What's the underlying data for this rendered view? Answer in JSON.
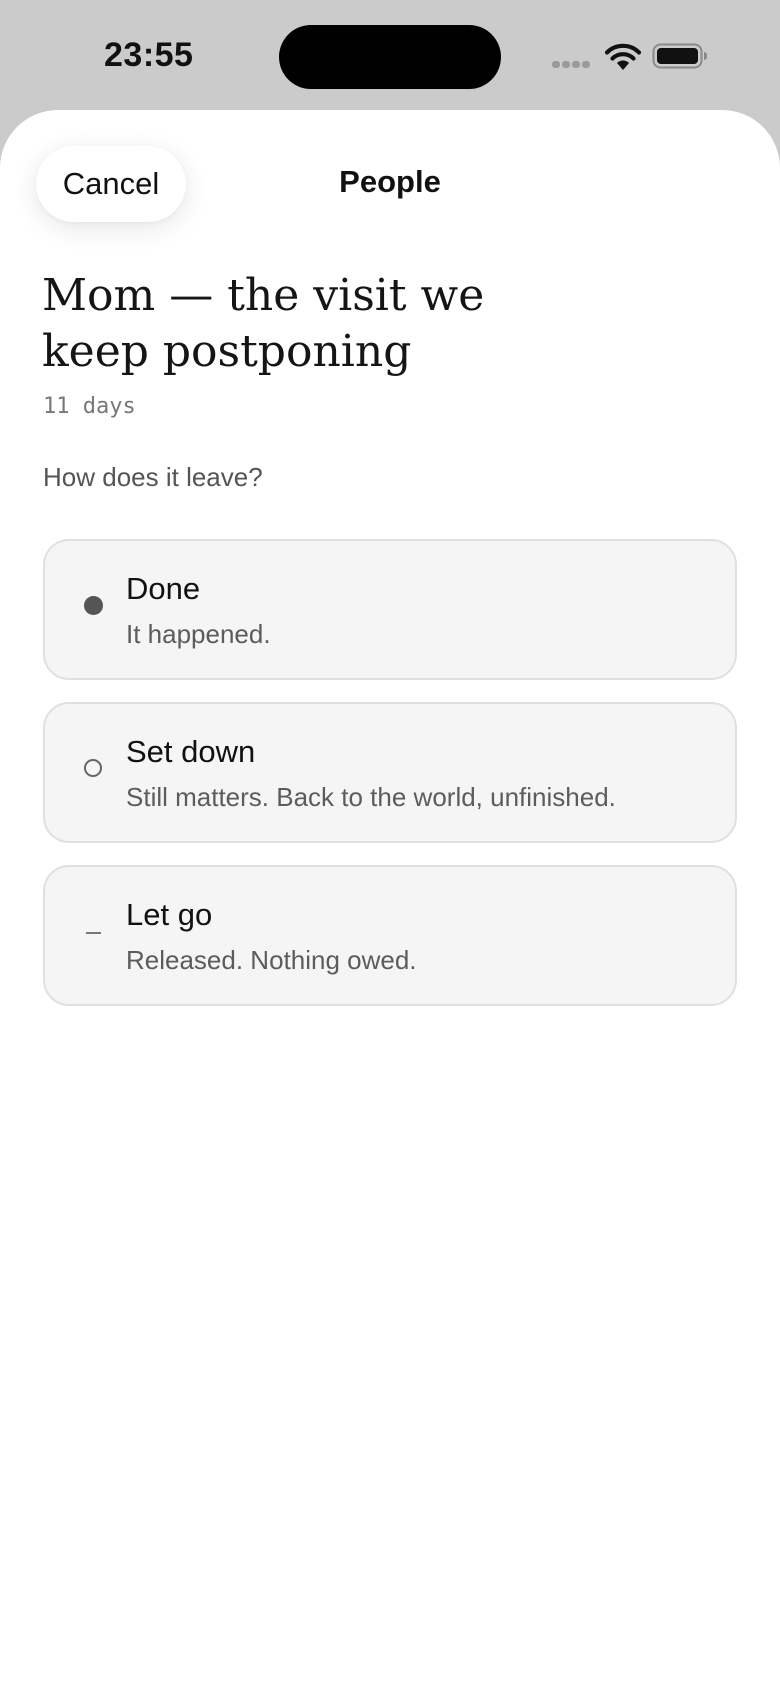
{
  "status_bar": {
    "time": "23:55",
    "icons": [
      "signal-icon",
      "wifi-icon",
      "battery-icon"
    ]
  },
  "header": {
    "cancel_label": "Cancel",
    "title": "People"
  },
  "item": {
    "title": "Mom — the visit we keep postponing",
    "age": "11 days"
  },
  "prompt": "How does it leave?",
  "options": [
    {
      "label": "Done",
      "description": "It happened.",
      "marker": "filled-dot",
      "selected": true
    },
    {
      "label": "Set down",
      "description": "Still matters. Back to the world, unfinished.",
      "marker": "ring",
      "selected": false
    },
    {
      "label": "Let go",
      "description": "Released. Nothing owed.",
      "marker": "dash",
      "selected": false
    }
  ],
  "colors": {
    "background": "#cbcbcb",
    "sheet": "#ffffff",
    "option_fill": "#f5f5f5",
    "option_border": "#e0e0e0",
    "text_primary": "#111111",
    "text_secondary": "#5c5c5c"
  }
}
